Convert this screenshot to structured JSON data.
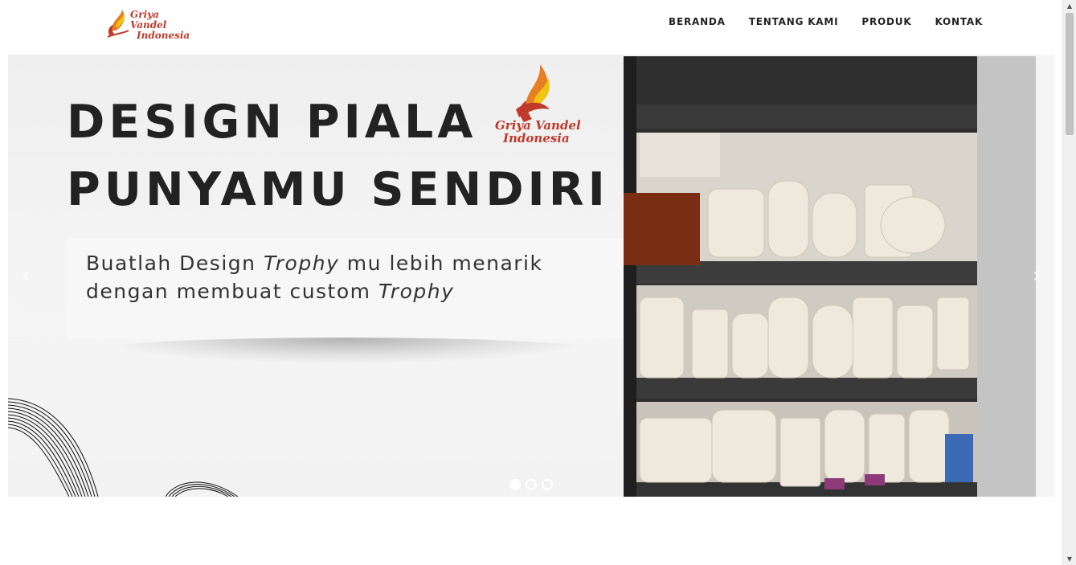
{
  "header": {
    "logo_line1": "Griya Vandel",
    "logo_line2": "Indonesia",
    "nav": [
      "BERANDA",
      "TENTANG KAMI",
      "PRODUK",
      "KONTAK"
    ]
  },
  "hero": {
    "headline_line1": "DESIGN PIALA",
    "headline_line2": "PUNYAMU SENDIRI",
    "badge_line1": "Griya Vandel",
    "badge_line2": "Indonesia",
    "sub_line1_a": "Buatlah Design ",
    "sub_line1_em": "Trophy",
    "sub_line1_b": " mu lebih menarik",
    "sub_line2_a": "dengan membuat custom ",
    "sub_line2_em": "Trophy",
    "prev_arrow": "‹",
    "next_arrow": "›",
    "dots_count": 3,
    "active_dot": 0
  },
  "colors": {
    "brand_red": "#c0392b",
    "brand_orange": "#f39c12",
    "heading": "#222222"
  },
  "scrollbar": {
    "up_arrow": "▲",
    "down_arrow": "▼"
  }
}
